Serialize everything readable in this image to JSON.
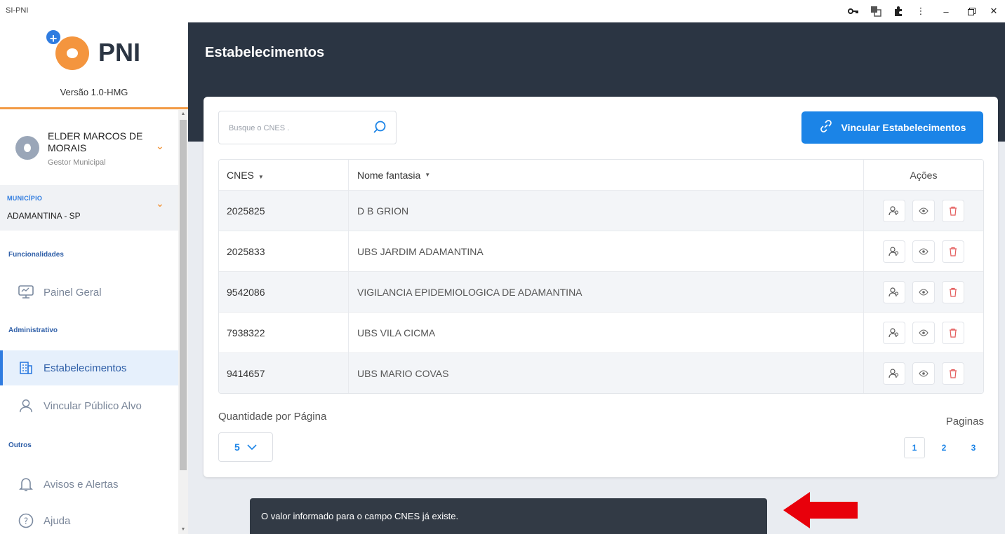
{
  "window": {
    "title": "SI-PNI",
    "icons": [
      "key-icon",
      "translate-icon",
      "extensions-icon",
      "more-icon",
      "minimize-icon",
      "restore-icon",
      "close-icon"
    ]
  },
  "sidebar": {
    "logo_text": "PNI",
    "version": "Versão 1.0-HMG",
    "user": {
      "name": "ELDER MARCOS DE MORAIS",
      "role": "Gestor Municipal"
    },
    "municipio": {
      "label": "MUNICÍPIO",
      "value": "ADAMANTINA - SP"
    },
    "sections": {
      "funcionalidades": "Funcionalidades",
      "administrativo": "Administrativo",
      "outros": "Outros"
    },
    "items": {
      "painel": "Painel Geral",
      "estabelecimentos": "Estabelecimentos",
      "vincular_publico": "Vincular Público Alvo",
      "avisos": "Avisos e Alertas",
      "ajuda": "Ajuda"
    }
  },
  "header": {
    "title": "Estabelecimentos"
  },
  "search": {
    "placeholder": "Busque o CNES ."
  },
  "actions": {
    "vincular_label": "Vincular Estabelecimentos"
  },
  "table": {
    "headers": {
      "cnes": "CNES",
      "nome": "Nome fantasia",
      "acoes": "Ações"
    },
    "rows": [
      {
        "cnes": "2025825",
        "nome": "D B GRION"
      },
      {
        "cnes": "2025833",
        "nome": "UBS JARDIM ADAMANTINA"
      },
      {
        "cnes": "9542086",
        "nome": "VIGILANCIA EPIDEMIOLOGICA DE ADAMANTINA"
      },
      {
        "cnes": "7938322",
        "nome": "UBS VILA CICMA"
      },
      {
        "cnes": "9414657",
        "nome": "UBS MARIO COVAS"
      }
    ]
  },
  "pagination": {
    "qpp_label": "Quantidade por Página",
    "qpp_value": "5",
    "pages_label": "Paginas",
    "pages": [
      "1",
      "2",
      "3"
    ],
    "current": "1"
  },
  "toast": {
    "message": "O valor informado para o campo CNES já existe."
  },
  "colors": {
    "accent": "#1b84e7",
    "header": "#2b3543",
    "brand_orange": "#f4953e",
    "annotation_arrow": "#e8000b"
  }
}
